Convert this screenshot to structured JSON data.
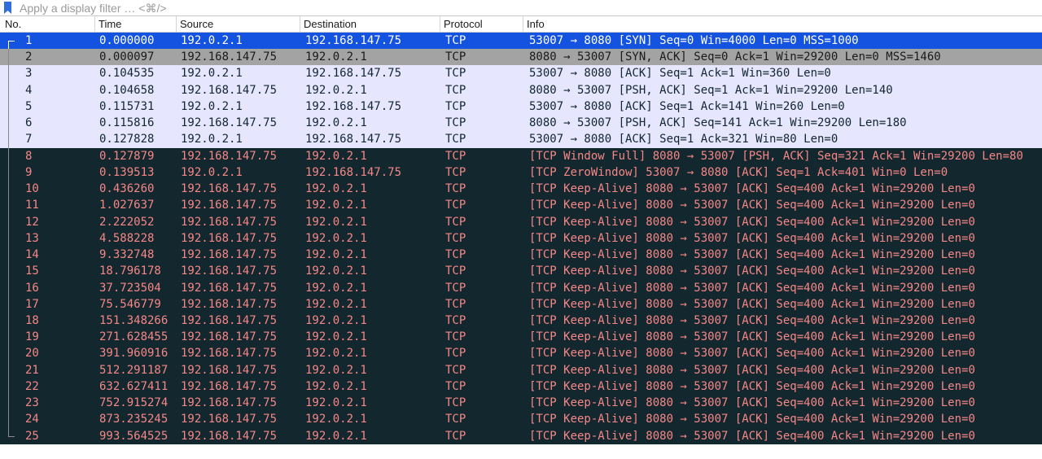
{
  "filter": {
    "placeholder": "Apply a display filter … <⌘/>"
  },
  "columns": {
    "no": "No.",
    "time": "Time",
    "source": "Source",
    "destination": "Destination",
    "protocol": "Protocol",
    "info": "Info"
  },
  "colors": {
    "selected_bg": "#1452e0",
    "selected_fg": "#ffffff",
    "related_bg": "#a3a3a3",
    "related_fg": "#1a1a1a",
    "tcp_bg": "#e7e6ff",
    "tcp_fg": "#12272e",
    "bad_bg": "#12272e",
    "bad_fg": "#f78787"
  },
  "packets": [
    {
      "no": "1",
      "time": "0.000000",
      "src": "192.0.2.1",
      "dst": "192.168.147.75",
      "proto": "TCP",
      "info": "53007 → 8080 [SYN] Seq=0 Win=4000 Len=0 MSS=1000",
      "style": "selected"
    },
    {
      "no": "2",
      "time": "0.000097",
      "src": "192.168.147.75",
      "dst": "192.0.2.1",
      "proto": "TCP",
      "info": "8080 → 53007 [SYN, ACK] Seq=0 Ack=1 Win=29200 Len=0 MSS=1460",
      "style": "related"
    },
    {
      "no": "3",
      "time": "0.104535",
      "src": "192.0.2.1",
      "dst": "192.168.147.75",
      "proto": "TCP",
      "info": "53007 → 8080 [ACK] Seq=1 Ack=1 Win=360 Len=0",
      "style": "tcp"
    },
    {
      "no": "4",
      "time": "0.104658",
      "src": "192.168.147.75",
      "dst": "192.0.2.1",
      "proto": "TCP",
      "info": "8080 → 53007 [PSH, ACK] Seq=1 Ack=1 Win=29200 Len=140",
      "style": "tcp"
    },
    {
      "no": "5",
      "time": "0.115731",
      "src": "192.0.2.1",
      "dst": "192.168.147.75",
      "proto": "TCP",
      "info": "53007 → 8080 [ACK] Seq=1 Ack=141 Win=260 Len=0",
      "style": "tcp"
    },
    {
      "no": "6",
      "time": "0.115816",
      "src": "192.168.147.75",
      "dst": "192.0.2.1",
      "proto": "TCP",
      "info": "8080 → 53007 [PSH, ACK] Seq=141 Ack=1 Win=29200 Len=180",
      "style": "tcp"
    },
    {
      "no": "7",
      "time": "0.127828",
      "src": "192.0.2.1",
      "dst": "192.168.147.75",
      "proto": "TCP",
      "info": "53007 → 8080 [ACK] Seq=1 Ack=321 Win=80 Len=0",
      "style": "tcp"
    },
    {
      "no": "8",
      "time": "0.127879",
      "src": "192.168.147.75",
      "dst": "192.0.2.1",
      "proto": "TCP",
      "info": "[TCP Window Full] 8080 → 53007 [PSH, ACK] Seq=321 Ack=1 Win=29200 Len=80",
      "style": "bad"
    },
    {
      "no": "9",
      "time": "0.139513",
      "src": "192.0.2.1",
      "dst": "192.168.147.75",
      "proto": "TCP",
      "info": "[TCP ZeroWindow] 53007 → 8080 [ACK] Seq=1 Ack=401 Win=0 Len=0",
      "style": "bad"
    },
    {
      "no": "10",
      "time": "0.436260",
      "src": "192.168.147.75",
      "dst": "192.0.2.1",
      "proto": "TCP",
      "info": "[TCP Keep-Alive] 8080 → 53007 [ACK] Seq=400 Ack=1 Win=29200 Len=0",
      "style": "bad"
    },
    {
      "no": "11",
      "time": "1.027637",
      "src": "192.168.147.75",
      "dst": "192.0.2.1",
      "proto": "TCP",
      "info": "[TCP Keep-Alive] 8080 → 53007 [ACK] Seq=400 Ack=1 Win=29200 Len=0",
      "style": "bad"
    },
    {
      "no": "12",
      "time": "2.222052",
      "src": "192.168.147.75",
      "dst": "192.0.2.1",
      "proto": "TCP",
      "info": "[TCP Keep-Alive] 8080 → 53007 [ACK] Seq=400 Ack=1 Win=29200 Len=0",
      "style": "bad"
    },
    {
      "no": "13",
      "time": "4.588228",
      "src": "192.168.147.75",
      "dst": "192.0.2.1",
      "proto": "TCP",
      "info": "[TCP Keep-Alive] 8080 → 53007 [ACK] Seq=400 Ack=1 Win=29200 Len=0",
      "style": "bad"
    },
    {
      "no": "14",
      "time": "9.332748",
      "src": "192.168.147.75",
      "dst": "192.0.2.1",
      "proto": "TCP",
      "info": "[TCP Keep-Alive] 8080 → 53007 [ACK] Seq=400 Ack=1 Win=29200 Len=0",
      "style": "bad"
    },
    {
      "no": "15",
      "time": "18.796178",
      "src": "192.168.147.75",
      "dst": "192.0.2.1",
      "proto": "TCP",
      "info": "[TCP Keep-Alive] 8080 → 53007 [ACK] Seq=400 Ack=1 Win=29200 Len=0",
      "style": "bad"
    },
    {
      "no": "16",
      "time": "37.723504",
      "src": "192.168.147.75",
      "dst": "192.0.2.1",
      "proto": "TCP",
      "info": "[TCP Keep-Alive] 8080 → 53007 [ACK] Seq=400 Ack=1 Win=29200 Len=0",
      "style": "bad"
    },
    {
      "no": "17",
      "time": "75.546779",
      "src": "192.168.147.75",
      "dst": "192.0.2.1",
      "proto": "TCP",
      "info": "[TCP Keep-Alive] 8080 → 53007 [ACK] Seq=400 Ack=1 Win=29200 Len=0",
      "style": "bad"
    },
    {
      "no": "18",
      "time": "151.348266",
      "src": "192.168.147.75",
      "dst": "192.0.2.1",
      "proto": "TCP",
      "info": "[TCP Keep-Alive] 8080 → 53007 [ACK] Seq=400 Ack=1 Win=29200 Len=0",
      "style": "bad"
    },
    {
      "no": "19",
      "time": "271.628455",
      "src": "192.168.147.75",
      "dst": "192.0.2.1",
      "proto": "TCP",
      "info": "[TCP Keep-Alive] 8080 → 53007 [ACK] Seq=400 Ack=1 Win=29200 Len=0",
      "style": "bad"
    },
    {
      "no": "20",
      "time": "391.960916",
      "src": "192.168.147.75",
      "dst": "192.0.2.1",
      "proto": "TCP",
      "info": "[TCP Keep-Alive] 8080 → 53007 [ACK] Seq=400 Ack=1 Win=29200 Len=0",
      "style": "bad"
    },
    {
      "no": "21",
      "time": "512.291187",
      "src": "192.168.147.75",
      "dst": "192.0.2.1",
      "proto": "TCP",
      "info": "[TCP Keep-Alive] 8080 → 53007 [ACK] Seq=400 Ack=1 Win=29200 Len=0",
      "style": "bad"
    },
    {
      "no": "22",
      "time": "632.627411",
      "src": "192.168.147.75",
      "dst": "192.0.2.1",
      "proto": "TCP",
      "info": "[TCP Keep-Alive] 8080 → 53007 [ACK] Seq=400 Ack=1 Win=29200 Len=0",
      "style": "bad"
    },
    {
      "no": "23",
      "time": "752.915274",
      "src": "192.168.147.75",
      "dst": "192.0.2.1",
      "proto": "TCP",
      "info": "[TCP Keep-Alive] 8080 → 53007 [ACK] Seq=400 Ack=1 Win=29200 Len=0",
      "style": "bad"
    },
    {
      "no": "24",
      "time": "873.235245",
      "src": "192.168.147.75",
      "dst": "192.0.2.1",
      "proto": "TCP",
      "info": "[TCP Keep-Alive] 8080 → 53007 [ACK] Seq=400 Ack=1 Win=29200 Len=0",
      "style": "bad"
    },
    {
      "no": "25",
      "time": "993.564525",
      "src": "192.168.147.75",
      "dst": "192.0.2.1",
      "proto": "TCP",
      "info": "[TCP Keep-Alive] 8080 → 53007 [ACK] Seq=400 Ack=1 Win=29200 Len=0",
      "style": "bad"
    }
  ]
}
